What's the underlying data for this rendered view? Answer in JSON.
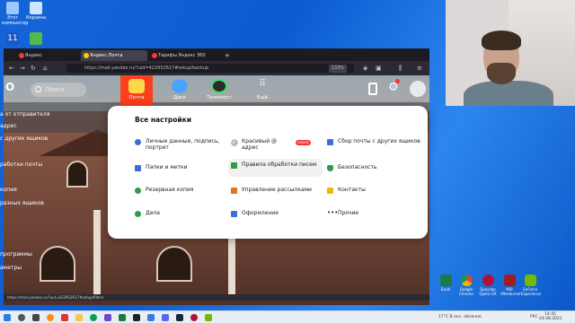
{
  "desktop": {
    "icons_top": [
      {
        "label": "Этот компьютер",
        "color": "#9ec6ff"
      },
      {
        "label": "Корзина",
        "color": "#cfe6ff"
      }
    ],
    "icons_right": [
      {
        "label": "Excel",
        "color": "#1d7a45"
      },
      {
        "label": "Google Chrome",
        "color": "#ffffff"
      },
      {
        "label": "Браузер Opera GX",
        "color": "#b11133"
      },
      {
        "label": "MSI Afterburner",
        "color": "#a31d1d"
      },
      {
        "label": "GeForce Experience",
        "color": "#76b900"
      }
    ]
  },
  "browser": {
    "tabs": [
      {
        "label": "Яндекс",
        "fav": "#ff3333"
      },
      {
        "label": "Яндекс.Почта",
        "fav": "#ffcc00",
        "active": true
      },
      {
        "label": "Тарифы Яндекс 360",
        "fav": "#ff3333"
      }
    ],
    "url": "https://mail.yandex.ru/?uid=422952617#setup/backup",
    "zoom": "133%",
    "status_url": "https://mail.yandex.ru/?uid=422952617#setup/filters"
  },
  "mail": {
    "search_placeholder": "Поиск",
    "services": [
      {
        "label": "Почта",
        "color": "#ffd84a",
        "active": true
      },
      {
        "label": "Диск",
        "color": "#4aa3ff"
      },
      {
        "label": "Телемост",
        "color": "#2b2b2b"
      },
      {
        "label": "Ещё",
        "color": "#888888"
      }
    ],
    "sidebar": [
      "а от отправителя",
      "адрес",
      "с других ящиков",
      "работки почты",
      "копия",
      "разных ящиков",
      "программы",
      "аметры"
    ]
  },
  "settings": {
    "title": "Все настройки",
    "items": [
      {
        "label": "Личные данные, подпись, портрет",
        "color": "#3b6fd6"
      },
      {
        "label": "Красивый @ адрес",
        "color": "#555555",
        "badge": "НОВОЕ"
      },
      {
        "label": "Сбор почты с других ящиков",
        "color": "#3b6fd6"
      },
      {
        "label": "Папки и метки",
        "color": "#3b6fd6"
      },
      {
        "label": "Правила обработки писем",
        "color": "#2f9b45"
      },
      {
        "label": "Безопасность",
        "color": "#2f9b45"
      },
      {
        "label": "Резервная копия",
        "color": "#2f9b45"
      },
      {
        "label": "Управление рассылками",
        "color": "#e8711c"
      },
      {
        "label": "Контакты",
        "color": "#f2b705"
      },
      {
        "label": "Дела",
        "color": "#2f9b45"
      },
      {
        "label": "Оформление",
        "color": "#3b6fd6"
      },
      {
        "label": "Прочие",
        "color": "#222222"
      }
    ]
  },
  "taskbar": {
    "weather": "17°C  В осн. облачно",
    "lang": "РУС",
    "time": "14:45",
    "date": "24.08.2021"
  }
}
